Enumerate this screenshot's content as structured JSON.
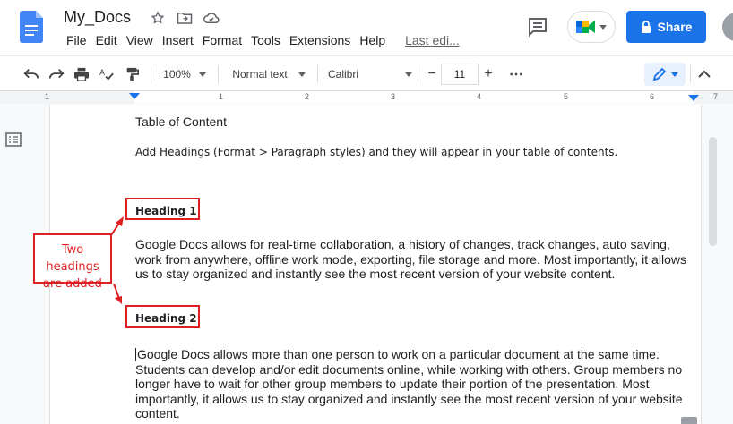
{
  "header": {
    "doc_title": "My_Docs",
    "menu": [
      "File",
      "Edit",
      "View",
      "Insert",
      "Format",
      "Tools",
      "Extensions",
      "Help"
    ],
    "last_edit": "Last edi...",
    "share_label": "Share"
  },
  "toolbar": {
    "zoom": "100%",
    "style": "Normal text",
    "font": "Calibri",
    "font_size": "11",
    "minus": "−",
    "plus": "+",
    "more": "⋯"
  },
  "ruler": {
    "numbers": [
      "1",
      "1",
      "2",
      "3",
      "4",
      "5",
      "6",
      "7"
    ]
  },
  "document": {
    "toc_title": "Table of Content",
    "toc_hint": "Add Headings (Format > Paragraph styles) and they will appear in your table of contents.",
    "heading1": "Heading 1",
    "heading2": "Heading 2",
    "paragraph1": "Google Docs allows for real-time collaboration, a history of changes, track changes, auto saving, work from anywhere, offline work mode, exporting, file storage and more. Most importantly, it allows us to stay organized and instantly see the most recent version of your website content.",
    "paragraph2": "Google Docs allows more than one person to work on a particular document at the same time. Students can develop and/or edit documents online, while working with others. Group members no longer have to wait for other group members to update their portion of the presentation. Most importantly, it allows us to stay organized and instantly see the most recent version of your website content."
  },
  "annotation": {
    "line1": "Two headings",
    "line2": "are added",
    "color": "#e02020"
  },
  "colors": {
    "accent": "#1a73e8",
    "doc_icon": "#4285f4"
  }
}
